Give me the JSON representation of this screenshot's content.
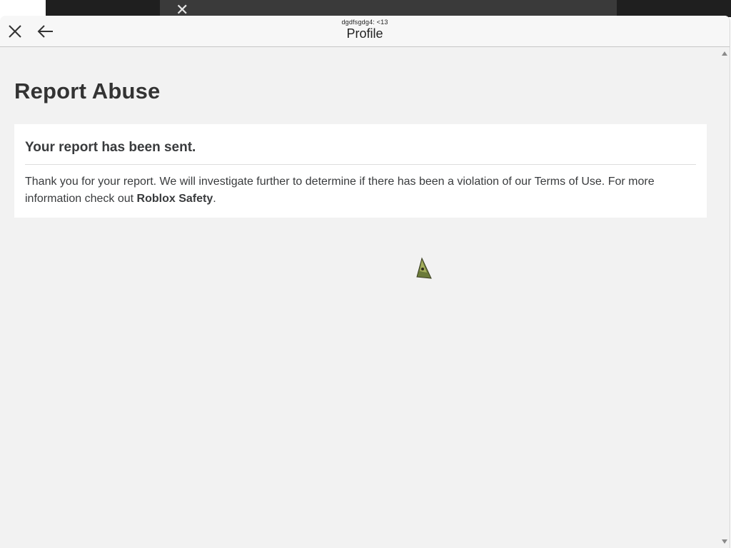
{
  "modal": {
    "subtitle": "dgdfsgdg4: <13",
    "title": "Profile"
  },
  "page": {
    "heading": "Report Abuse"
  },
  "card": {
    "title": "Your report has been sent.",
    "text_before": "Thank you for your report. We will investigate further to determine if there has been a violation of our Terms of Use. For more information check out ",
    "link_text": "Roblox Safety",
    "text_after": "."
  },
  "icons": {
    "close": "close-icon",
    "back": "arrow-left-icon",
    "background_close": "close-icon",
    "center": "avatar-figure-icon"
  },
  "colors": {
    "modal_bg": "#f2f2f2",
    "header_bg": "#f7f7f7",
    "card_bg": "#ffffff",
    "text": "#393b3d"
  }
}
